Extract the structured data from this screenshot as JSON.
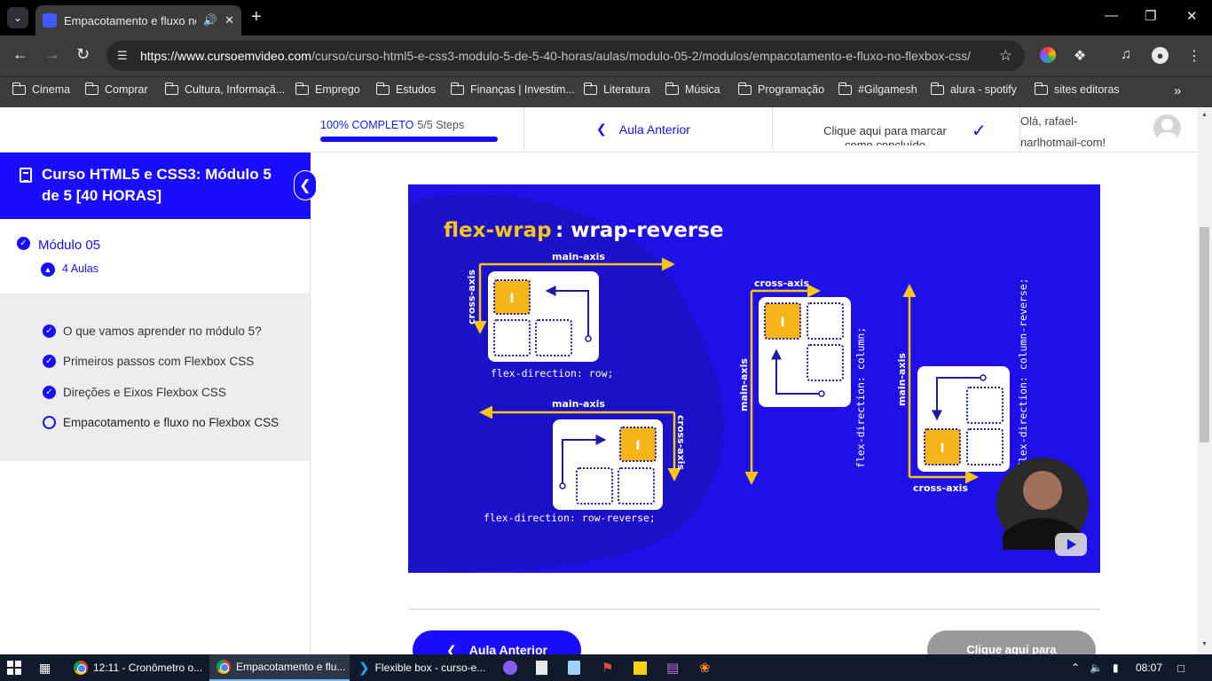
{
  "browser": {
    "tab_title": "Empacotamento e fluxo no",
    "url_domain": "https://www.cursoemvideo.com",
    "url_path": "/curso/curso-html5-e-css3-modulo-5-de-5-40-horas/aulas/modulo-05-2/modulos/empacotamento-e-fluxo-no-flexbox-css/"
  },
  "bookmarks": [
    {
      "label": "Cinema"
    },
    {
      "label": "Comprar"
    },
    {
      "label": "Cultura, Informaçã..."
    },
    {
      "label": "Emprego"
    },
    {
      "label": "Estudos"
    },
    {
      "label": "Finanças | Investim..."
    },
    {
      "label": "Literatura"
    },
    {
      "label": "Música"
    },
    {
      "label": "Programação"
    },
    {
      "label": "#Gilgamesh"
    },
    {
      "label": "alura - spotify"
    },
    {
      "label": "sites editoras"
    }
  ],
  "topbar": {
    "progress_label": "100% COMPLETO",
    "progress_steps": "5/5 Steps",
    "progress_fraction": 1.0,
    "prev_label": "Aula Anterior",
    "mark_done": "Clique aqui para marcar como concluído",
    "hello_line1": "Olá, rafael-",
    "hello_line2": "narlhotmail-com!"
  },
  "sidebar": {
    "course_title": "Curso HTML5 e CSS3: Módulo 5 de 5 [40 HORAS]",
    "module_title": "Módulo 05",
    "module_count": "4 Aulas",
    "lessons": [
      {
        "label": "O que vamos aprender no módulo 5?",
        "done": true
      },
      {
        "label": "Primeiros passos com Flexbox CSS",
        "done": true
      },
      {
        "label": "Direções e Eixos Flexbox CSS",
        "done": true
      },
      {
        "label": "Empacotamento e fluxo no Flexbox CSS",
        "done": false
      }
    ]
  },
  "slide": {
    "title_a": "flex-wrap",
    "title_b": ": wrap-reverse",
    "main_axis": "main-axis",
    "cross_axis": "cross-axis",
    "cap_row": "flex-direction: row;",
    "cap_row_reverse": "flex-direction: row-reverse;",
    "cap_column": "flex-direction: column;",
    "cap_column_reverse": "flex-direction: column-reverse;",
    "item_label": "I"
  },
  "bottom": {
    "prev_label": "Aula Anterior",
    "mark_label": "Clique aqui para"
  },
  "taskbar": {
    "items": [
      {
        "label": "12:11 - Cronômetro o..."
      },
      {
        "label": "Empacotamento e flu..."
      },
      {
        "label": "Flexible box - curso-e..."
      }
    ],
    "clock": "08:07"
  },
  "colors": {
    "accent": "#1a0dff",
    "slide_bg": "#1e10e6",
    "slide_yellow": "#f5c518",
    "item_orange": "#f5b418"
  }
}
